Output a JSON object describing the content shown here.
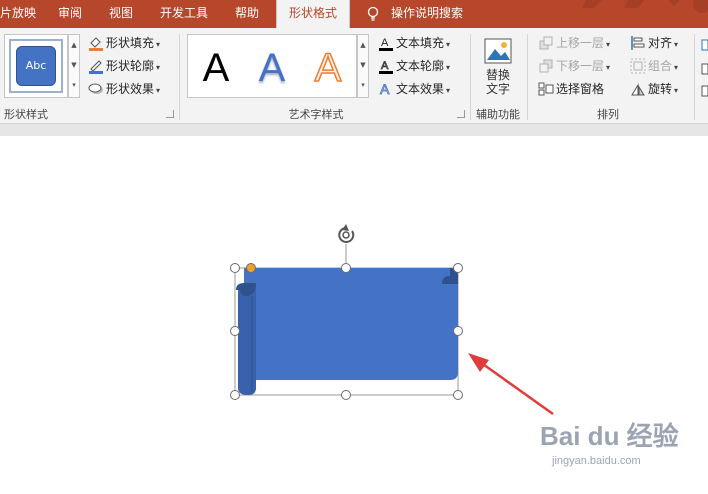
{
  "tabs": [
    {
      "label": "片放映",
      "active": false
    },
    {
      "label": "审阅",
      "active": false
    },
    {
      "label": "视图",
      "active": false
    },
    {
      "label": "开发工具",
      "active": false
    },
    {
      "label": "帮助",
      "active": false
    },
    {
      "label": "形状格式",
      "active": true
    },
    {
      "label": "操作说明搜索",
      "active": false
    }
  ],
  "ribbon": {
    "shape_styles": {
      "thumbnail_text": "Abc",
      "fill_label": "形状填充",
      "outline_label": "形状轮廓",
      "effects_label": "形状效果",
      "group_label": "形状样式"
    },
    "wordart_styles": {
      "samples": [
        "A",
        "A",
        "A"
      ],
      "text_fill_label": "文本填充",
      "text_outline_label": "文本轮廓",
      "text_effects_label": "文本效果",
      "group_label": "艺术字样式"
    },
    "accessibility": {
      "alt_text_line1": "替换",
      "alt_text_line2": "文字",
      "group_label": "辅助功能"
    },
    "arrange": {
      "bring_forward_label": "上移一层",
      "send_backward_label": "下移一层",
      "selection_pane_label": "选择窗格",
      "align_label": "对齐",
      "group_label_cmd": "组合",
      "rotate_label": "旋转",
      "group_label": "排列"
    }
  },
  "colors": {
    "tab_bar": "#b7472a",
    "shape_fill": "#4472c4",
    "shape_dark": "#2f528f",
    "arrow": "#e03c3c",
    "adjust_handle": "#f0a030"
  },
  "watermark": {
    "logo_text": "Bai du 经验",
    "sub_text": "jingyan.baidu.com"
  }
}
